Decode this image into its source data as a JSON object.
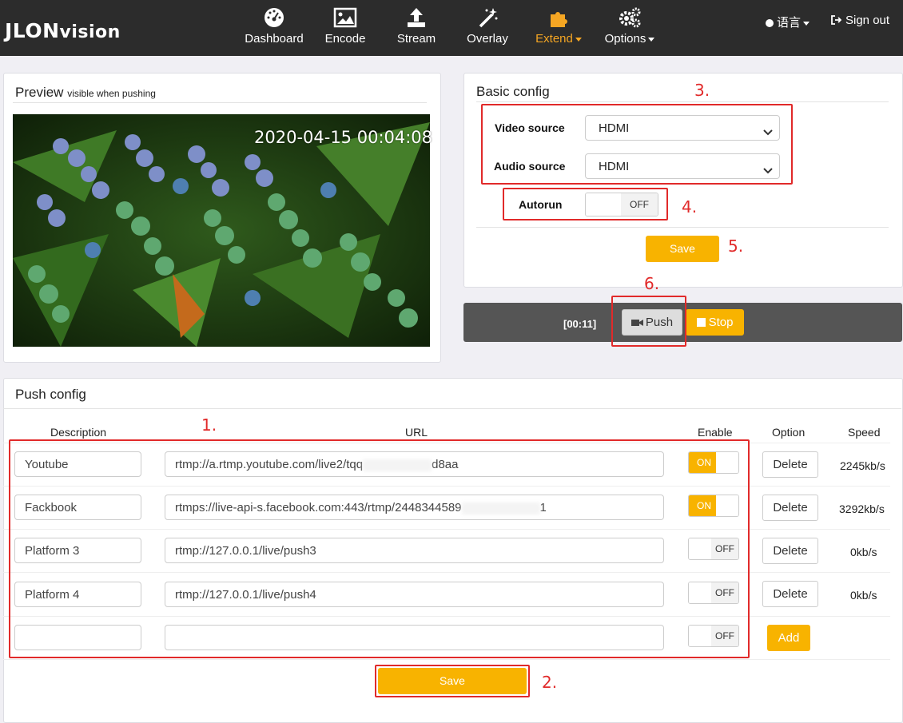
{
  "brand": {
    "logo_main": "JLON",
    "logo_suffix": "vision"
  },
  "nav": {
    "items": [
      {
        "label": "Dashboard",
        "icon": "dashboard-gauge-icon"
      },
      {
        "label": "Encode",
        "icon": "image-icon"
      },
      {
        "label": "Stream",
        "icon": "upload-icon"
      },
      {
        "label": "Overlay",
        "icon": "magic-wand-icon"
      },
      {
        "label": "Extend",
        "icon": "puzzle-icon",
        "active": true
      },
      {
        "label": "Options",
        "icon": "gears-icon"
      }
    ],
    "language": "语言",
    "signout": "Sign out",
    "active_color": "#f5a623"
  },
  "preview": {
    "title": "Preview",
    "subtitle": "visible when pushing",
    "timestamp": "2020-04-15 00:04:08"
  },
  "basic_config": {
    "title": "Basic config",
    "video_source_label": "Video source",
    "video_source_value": "HDMI",
    "audio_source_label": "Audio source",
    "audio_source_value": "HDMI",
    "autorun_label": "Autorun",
    "autorun_state": "OFF",
    "save_label": "Save"
  },
  "status": {
    "time": "[00:11]",
    "push_label": "Push",
    "stop_label": "Stop"
  },
  "push_config": {
    "title": "Push config",
    "headers": {
      "description": "Description",
      "url": "URL",
      "enable": "Enable",
      "option": "Option",
      "speed": "Speed"
    },
    "rows": [
      {
        "description": "Youtube",
        "url": "rtmp://a.rtmp.youtube.com/live2/tqq",
        "url_tail": "d8aa",
        "enabled": "ON",
        "option": "Delete",
        "speed": "2245kb/s"
      },
      {
        "description": "Fackbook",
        "url": "rtmps://live-api-s.facebook.com:443/rtmp/2448344589",
        "url_tail": "1",
        "enabled": "ON",
        "option": "Delete",
        "speed": "3292kb/s"
      },
      {
        "description": "Platform 3",
        "url": "rtmp://127.0.0.1/live/push3",
        "enabled": "OFF",
        "option": "Delete",
        "speed": "0kb/s"
      },
      {
        "description": "Platform 4",
        "url": "rtmp://127.0.0.1/live/push4",
        "enabled": "OFF",
        "option": "Delete",
        "speed": "0kb/s"
      },
      {
        "description": "",
        "url": "",
        "enabled": "OFF",
        "option": "Add",
        "speed": ""
      }
    ],
    "save_label": "Save"
  },
  "annotations": [
    "1.",
    "2.",
    "3.",
    "4.",
    "5.",
    "6."
  ],
  "colors": {
    "accent": "#f8b300",
    "annotation_red": "#e12a2a",
    "navbar": "#2c2c2c"
  }
}
